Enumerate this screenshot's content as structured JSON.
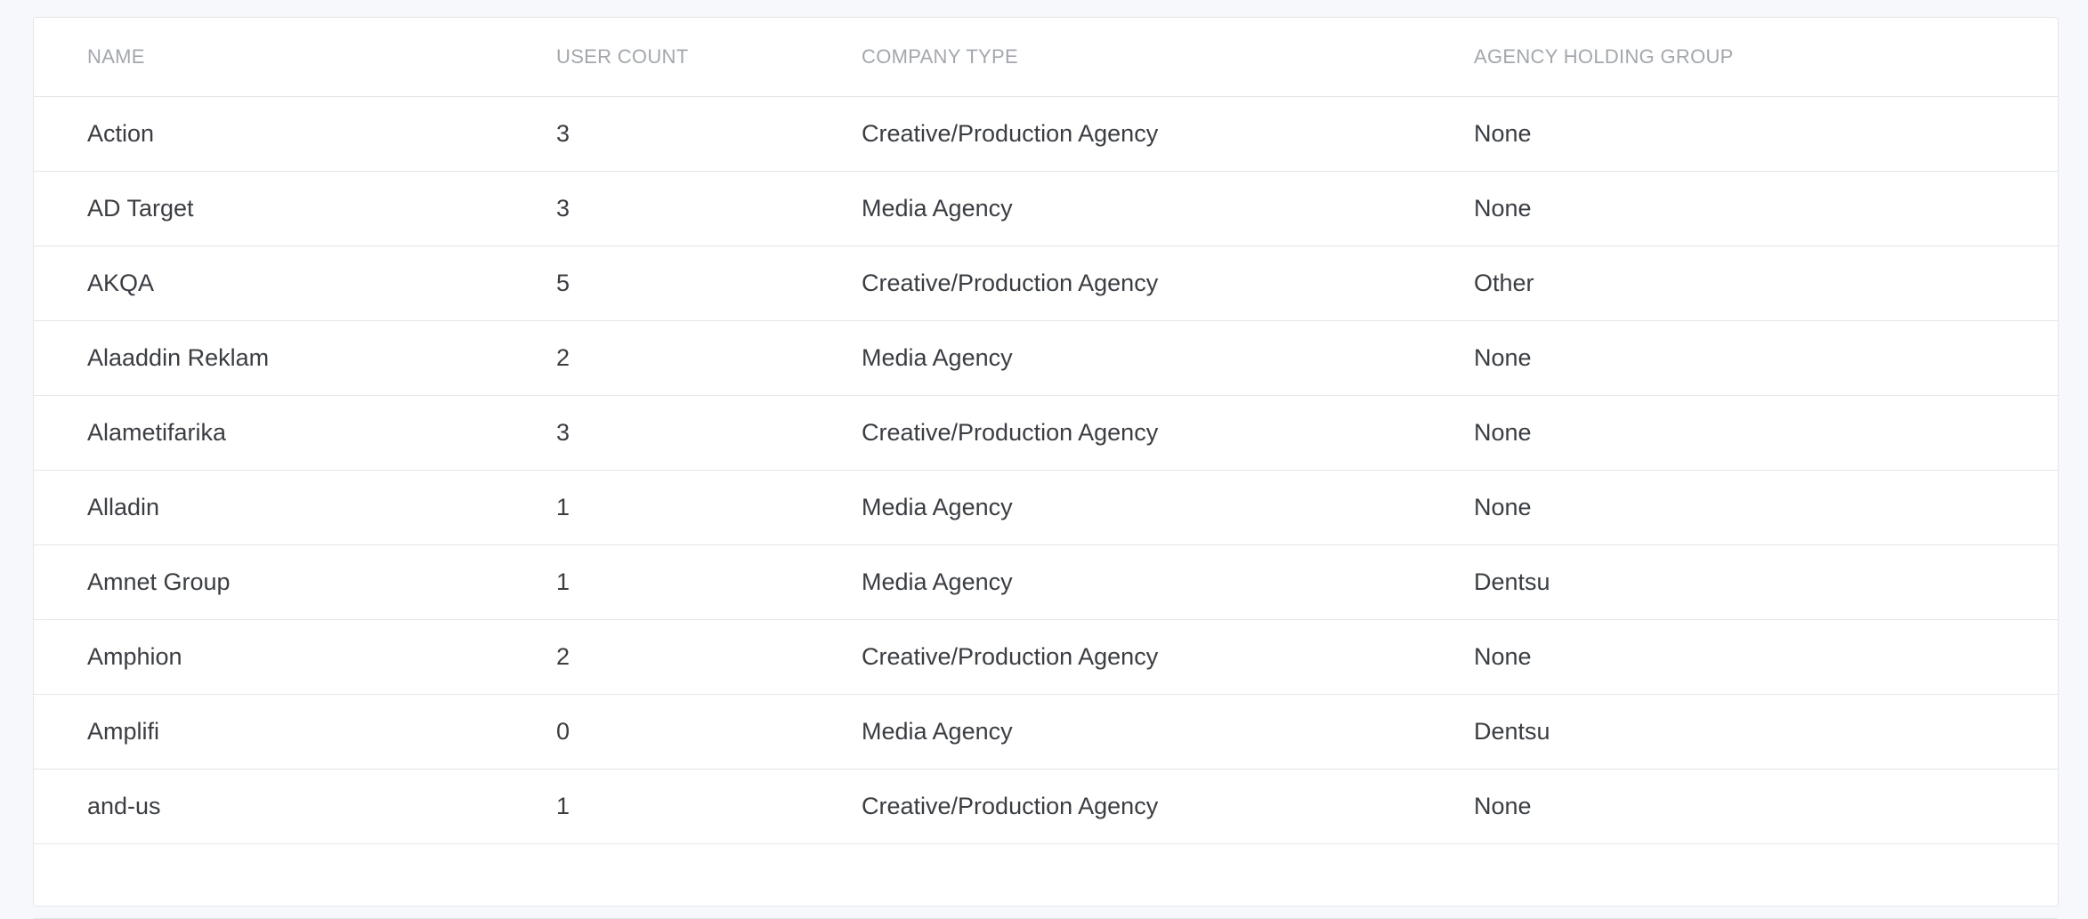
{
  "table": {
    "columns": [
      "NAME",
      "USER COUNT",
      "COMPANY TYPE",
      "AGENCY HOLDING GROUP"
    ],
    "rows": [
      {
        "name": "Action",
        "user_count": "3",
        "company_type": "Creative/Production Agency",
        "holding_group": "None"
      },
      {
        "name": "AD Target",
        "user_count": "3",
        "company_type": "Media Agency",
        "holding_group": "None"
      },
      {
        "name": "AKQA",
        "user_count": "5",
        "company_type": "Creative/Production Agency",
        "holding_group": "Other"
      },
      {
        "name": "Alaaddin Reklam",
        "user_count": "2",
        "company_type": "Media Agency",
        "holding_group": "None"
      },
      {
        "name": "Alametifarika",
        "user_count": "3",
        "company_type": "Creative/Production Agency",
        "holding_group": "None"
      },
      {
        "name": "Alladin",
        "user_count": "1",
        "company_type": "Media Agency",
        "holding_group": "None"
      },
      {
        "name": "Amnet Group",
        "user_count": "1",
        "company_type": "Media Agency",
        "holding_group": "Dentsu"
      },
      {
        "name": "Amphion",
        "user_count": "2",
        "company_type": "Creative/Production Agency",
        "holding_group": "None"
      },
      {
        "name": "Amplifi",
        "user_count": "0",
        "company_type": "Media Agency",
        "holding_group": "Dentsu"
      },
      {
        "name": "and-us",
        "user_count": "1",
        "company_type": "Creative/Production Agency",
        "holding_group": "None"
      }
    ]
  }
}
